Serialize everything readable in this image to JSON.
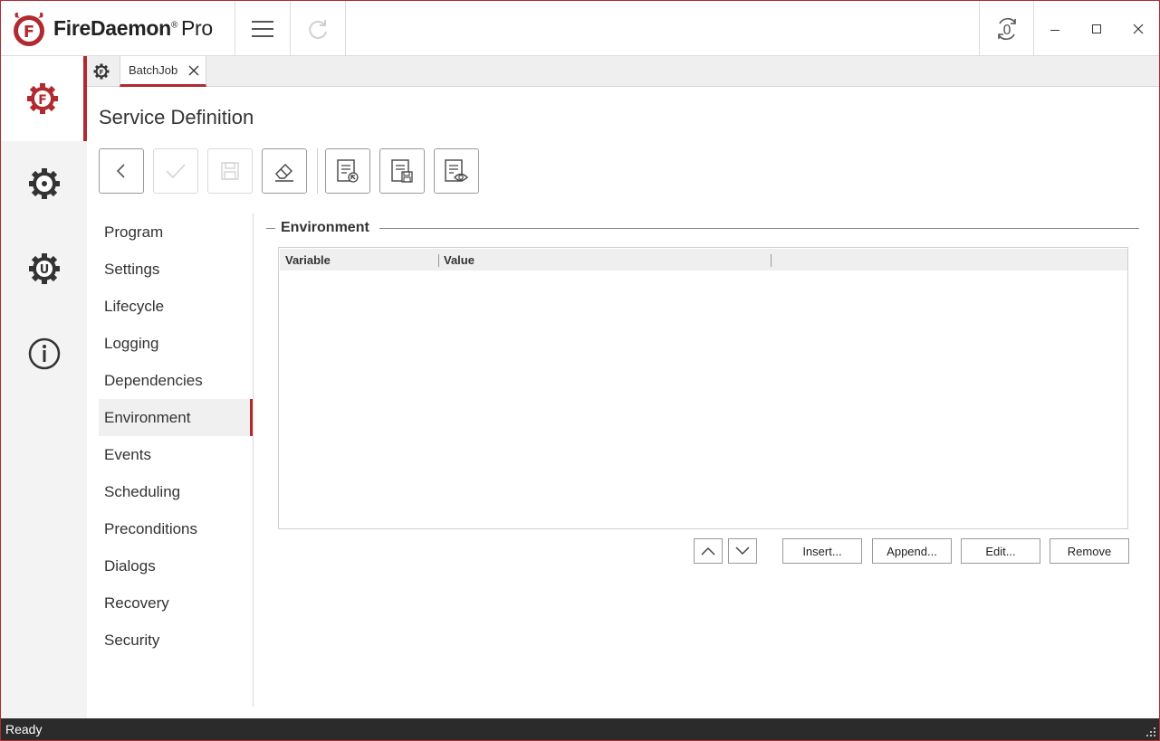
{
  "app": {
    "name": "FireDaemon",
    "edition": "Pro",
    "registered_mark": "®"
  },
  "titlebar": {
    "menu_icon": "hamburger-icon",
    "refresh_icon": "redo-icon",
    "session_icon": "session-zero-icon",
    "session_label": "0"
  },
  "rail": {
    "items": [
      {
        "name": "services",
        "icon": "firedaemon-gear-icon",
        "active": true
      },
      {
        "name": "settings",
        "icon": "gear-icon",
        "active": false
      },
      {
        "name": "updates",
        "icon": "update-gear-icon",
        "active": false
      },
      {
        "name": "about",
        "icon": "info-icon",
        "active": false
      }
    ]
  },
  "tabs": {
    "home_icon": "firedaemon-gear-icon",
    "items": [
      {
        "label": "BatchJob",
        "active": true
      }
    ]
  },
  "page": {
    "title": "Service Definition"
  },
  "toolbar": {
    "items": [
      {
        "name": "back",
        "icon": "chevron-left-icon",
        "enabled": true
      },
      {
        "name": "apply",
        "icon": "check-icon",
        "enabled": false
      },
      {
        "name": "save",
        "icon": "floppy-icon",
        "enabled": false
      },
      {
        "name": "clear",
        "icon": "eraser-icon",
        "enabled": true
      },
      {
        "name": "import",
        "icon": "document-import-icon",
        "enabled": true
      },
      {
        "name": "export",
        "icon": "document-save-icon",
        "enabled": true
      },
      {
        "name": "view",
        "icon": "document-view-icon",
        "enabled": true
      }
    ]
  },
  "nav": {
    "items": [
      {
        "label": "Program"
      },
      {
        "label": "Settings"
      },
      {
        "label": "Lifecycle"
      },
      {
        "label": "Logging"
      },
      {
        "label": "Dependencies"
      },
      {
        "label": "Environment",
        "active": true
      },
      {
        "label": "Events"
      },
      {
        "label": "Scheduling"
      },
      {
        "label": "Preconditions"
      },
      {
        "label": "Dialogs"
      },
      {
        "label": "Recovery"
      },
      {
        "label": "Security"
      }
    ]
  },
  "environment": {
    "group_title": "Environment",
    "columns": [
      "Variable",
      "Value"
    ],
    "rows": [],
    "buttons": {
      "move_up_icon": "chevron-up-icon",
      "move_down_icon": "chevron-down-icon",
      "insert": "Insert...",
      "append": "Append...",
      "edit": "Edit...",
      "remove": "Remove"
    }
  },
  "status": {
    "text": "Ready"
  },
  "colors": {
    "accent": "#b02a30",
    "status_bar": "#2b2b2b"
  }
}
